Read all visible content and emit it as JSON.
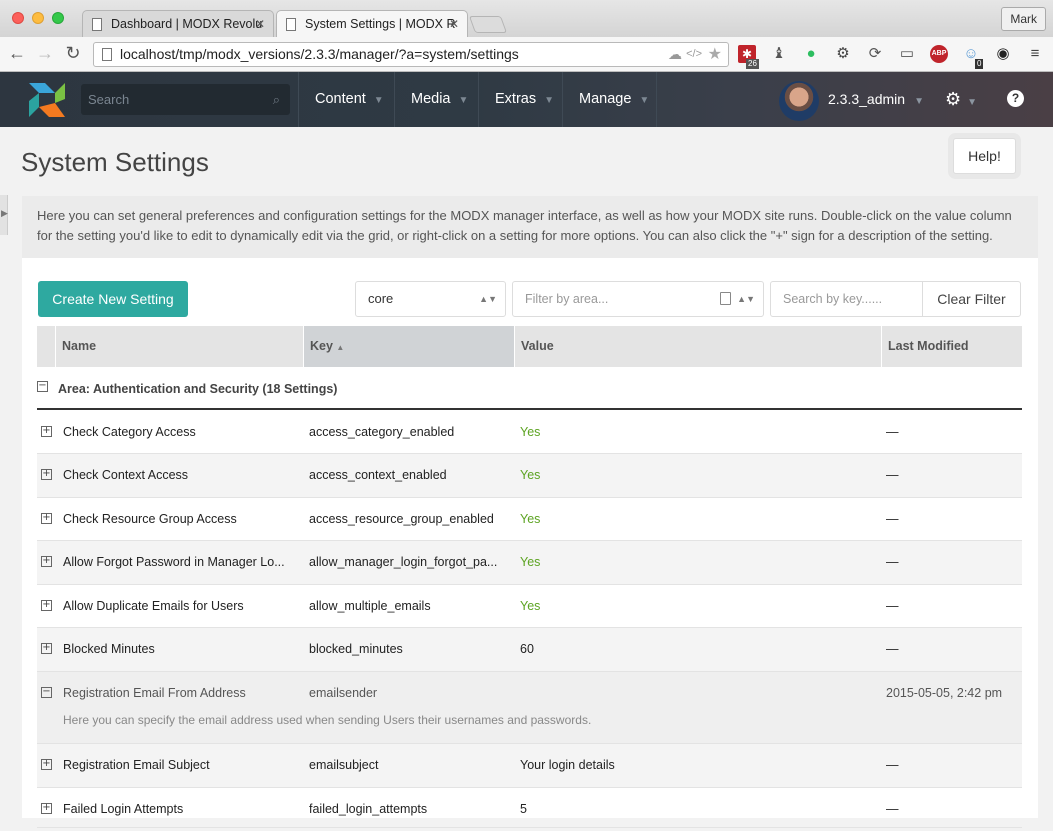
{
  "browser": {
    "tabs": [
      {
        "title": "Dashboard | MODX Revolu",
        "active": false
      },
      {
        "title": "System Settings | MODX R",
        "active": true
      }
    ],
    "profile": "Mark",
    "url": "localhost/tmp/modx_versions/2.3.3/manager/?a=system/settings",
    "extension_badges": {
      "lastpass": "26",
      "ghostery": "0"
    },
    "extension_icons": [
      "cloud-icon",
      "code-icon",
      "bookmark-star-icon",
      "lastpass-icon",
      "chess-icon",
      "evernote-icon",
      "settings-icon",
      "refresh-icon",
      "cast-icon",
      "adblock-icon",
      "ghostery-icon",
      "eye-icon",
      "menu-icon"
    ]
  },
  "header": {
    "search_placeholder": "Search",
    "nav": [
      {
        "label": "Content"
      },
      {
        "label": "Media"
      },
      {
        "label": "Extras"
      },
      {
        "label": "Manage"
      }
    ],
    "username": "2.3.3_admin",
    "brand_colors": {
      "accent": "#2ea9a0",
      "header_bg": "#2f3a44"
    }
  },
  "page": {
    "title": "System Settings",
    "help_label": "Help!",
    "description": "Here you can set general preferences and configuration settings for the MODX manager interface, as well as how your MODX site runs. Double-click on the value column for the setting you'd like to edit to dynamically edit via the grid, or right-click on a setting for more options. You can also click the \"+\" sign for a description of the setting."
  },
  "filters": {
    "create_label": "Create New Setting",
    "namespace_value": "core",
    "area_placeholder": "Filter by area...",
    "search_placeholder": "Search by key......",
    "clear_label": "Clear Filter"
  },
  "grid": {
    "columns": {
      "name": "Name",
      "key": "Key",
      "value": "Value",
      "modified": "Last Modified"
    },
    "sort": {
      "column": "Key",
      "direction": "asc"
    },
    "group_label": "Area: Authentication and Security (18 Settings)",
    "rows": [
      {
        "name": "Check Category Access",
        "key": "access_category_enabled",
        "value": "Yes",
        "modified": "—"
      },
      {
        "name": "Check Context Access",
        "key": "access_context_enabled",
        "value": "Yes",
        "modified": "—"
      },
      {
        "name": "Check Resource Group Access",
        "key": "access_resource_group_enabled",
        "value": "Yes",
        "modified": "—"
      },
      {
        "name": "Allow Forgot Password in Manager Lo...",
        "key": "allow_manager_login_forgot_pa...",
        "value": "Yes",
        "modified": "—"
      },
      {
        "name": "Allow Duplicate Emails for Users",
        "key": "allow_multiple_emails",
        "value": "Yes",
        "modified": "—"
      },
      {
        "name": "Blocked Minutes",
        "key": "blocked_minutes",
        "value": "60",
        "modified": "—"
      },
      {
        "name": "Registration Email From Address",
        "key": "emailsender",
        "value": "",
        "modified": "2015-05-05, 2:42 pm",
        "description": "Here you can specify the email address used when sending Users their usernames and passwords."
      },
      {
        "name": "Registration Email Subject",
        "key": "emailsubject",
        "value": "Your login details",
        "modified": "—"
      },
      {
        "name": "Failed Login Attempts",
        "key": "failed_login_attempts",
        "value": "5",
        "modified": "—"
      }
    ]
  }
}
